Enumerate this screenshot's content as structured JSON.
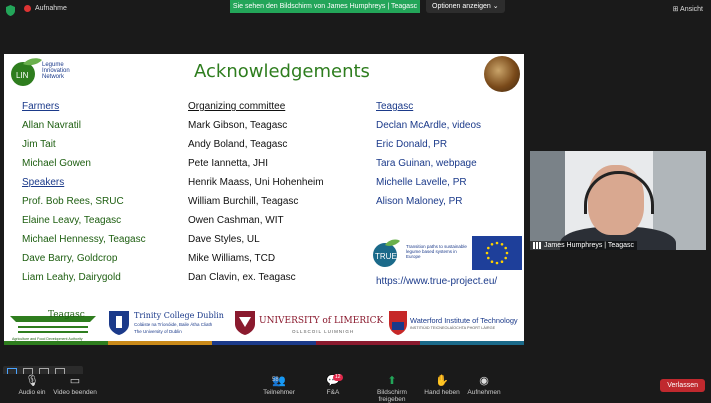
{
  "topbar": {
    "recording_label": "Aufnahme",
    "share_banner": "Sie sehen den Bildschirm von James Humphreys | Teagasc",
    "options_label": "Optionen anzeigen",
    "options_chevron": "⌄",
    "view_label": "Ansicht",
    "view_icon": "⊞"
  },
  "slide": {
    "title": "Acknowledgements",
    "logo_text": [
      "Legume",
      "Innovation",
      "Network"
    ],
    "logo_initials": "LIN",
    "farmers": {
      "heading": "Farmers",
      "names": [
        "Allan Navratil",
        "Jim Tait",
        "Michael Gowen"
      ]
    },
    "speakers": {
      "heading": "Speakers",
      "names": [
        "Prof. Bob Rees, SRUC",
        "Elaine Leavy, Teagasc",
        "Michael Hennessy, Teagasc",
        "Dave Barry, Goldcrop",
        "Liam Leahy, Dairygold"
      ]
    },
    "organizing": {
      "heading": "Organizing committee",
      "names": [
        "Mark Gibson, Teagasc",
        "Andy Boland, Teagasc",
        "Pete Iannetta, JHI",
        "Henrik Maass, Uni Hohenheim",
        "William Burchill, Teagasc",
        "Owen Cashman, WIT",
        "Dave Styles, UL",
        "Mike Williams, TCD",
        "Dan Clavin, ex. Teagasc"
      ]
    },
    "teagasc": {
      "heading": "Teagasc",
      "names": [
        "Declan McArdle, videos",
        "Eric Donald, PR",
        "Tara Guinan, webpage",
        "Michelle Lavelle, PR",
        "Alison Maloney, PR"
      ]
    },
    "true_logo": "TRUE",
    "true_text": "Transition paths to sustainable legume based systems in Europe",
    "url": "https://www.true-project.eu/",
    "footer_logos": {
      "teagasc": "Teagasc",
      "teagasc_sub": "Agriculture and Food Development Authority",
      "tcd": "Trinity College Dublin",
      "tcd_sub1": "Coláiste na Tríonóide, Baile Átha Cliath",
      "tcd_sub2": "The University of Dublin",
      "ul": "UNIVERSITY of LIMERICK",
      "ul_sub": "OLLSCOIL LUIMNIGH",
      "wit": "Waterford Institute of Technology",
      "wit_sub": "INSTITIÚID TEICNEOLAÍOCHTA PHORT LÁIRGE"
    }
  },
  "camera": {
    "participant_label": "James Humphreys | Teagasc"
  },
  "toolbar": {
    "audio_label": "Audio ein",
    "video_label": "Video beenden",
    "participants_label": "Teilnehmer",
    "participants_count": "58",
    "qa_label": "F&A",
    "qa_badge": "12",
    "share_label": "Bildschirm freigeben",
    "raise_hand_label": "Hand heben",
    "record_label": "Aufnehmen",
    "leave_label": "Verlassen"
  },
  "colors": {
    "share_green": "#23a559",
    "leave_red": "#c0292e",
    "title_green": "#2e7d1e",
    "text_blue": "#1b3a8a"
  }
}
